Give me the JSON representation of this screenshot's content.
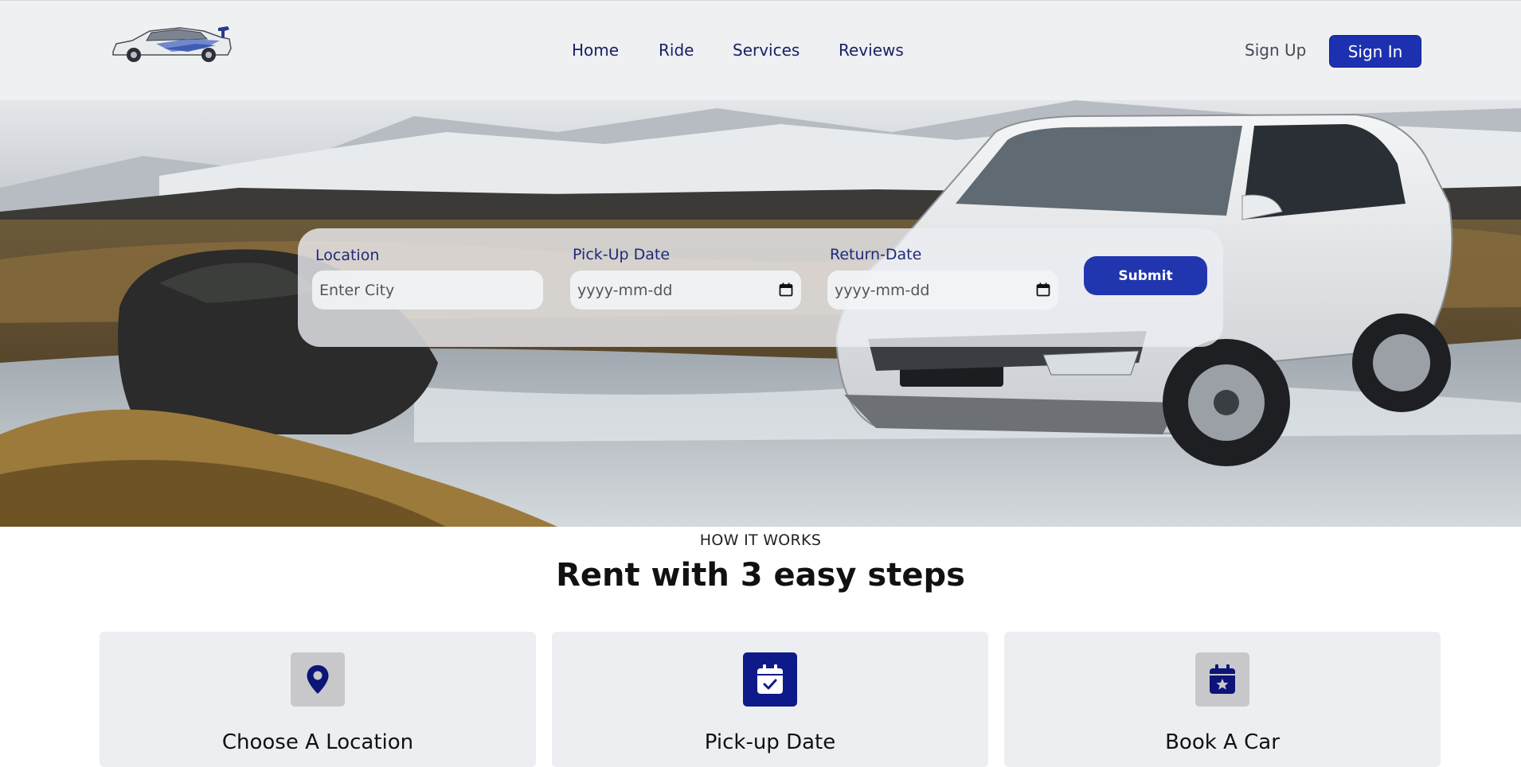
{
  "header": {
    "logo_alt": "sports car logo",
    "nav": [
      {
        "label": "Home"
      },
      {
        "label": "Ride"
      },
      {
        "label": "Services"
      },
      {
        "label": "Reviews"
      }
    ],
    "signup_label": "Sign Up",
    "signin_label": "Sign In"
  },
  "search": {
    "location_label": "Location",
    "location_placeholder": "Enter City",
    "pickup_label": "Pick-Up Date",
    "pickup_placeholder": "yyyy-mm-dd",
    "return_label": "Return-Date",
    "return_placeholder": "yyyy-mm-dd",
    "submit_label": "Submit"
  },
  "how_it_works": {
    "eyebrow": "HOW IT WORKS",
    "title": "Rent with 3 easy steps",
    "steps": [
      {
        "title": "Choose A Location",
        "icon": "location-pin-icon"
      },
      {
        "title": "Pick-up Date",
        "icon": "calendar-check-icon"
      },
      {
        "title": "Book A Car",
        "icon": "calendar-star-icon"
      }
    ]
  },
  "colors": {
    "brand_blue": "#1d31b0",
    "nav_text": "#1a2166",
    "header_bg": "#eef0f2"
  }
}
